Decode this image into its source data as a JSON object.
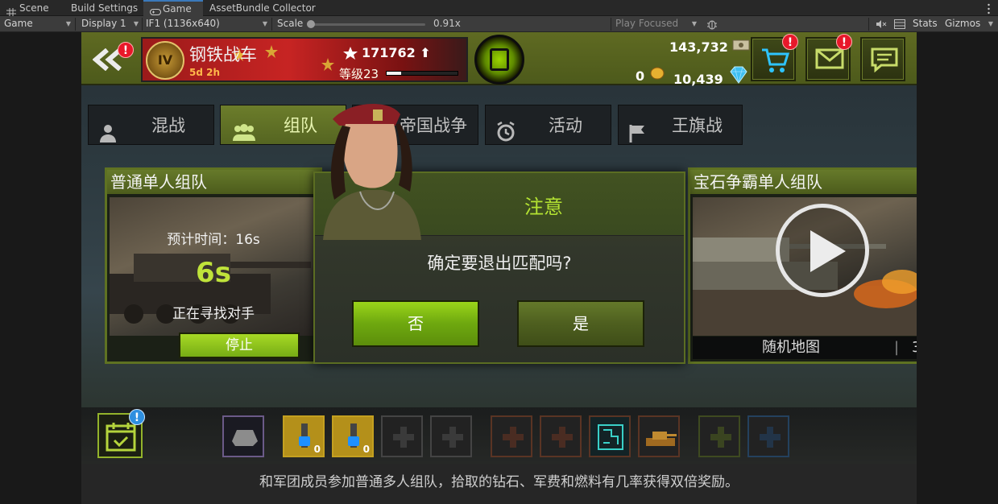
{
  "editor": {
    "tabs": [
      {
        "label": "Scene",
        "icon": "grid-icon"
      },
      {
        "label": "Build Settings"
      },
      {
        "label": "Game",
        "icon": "gamepad-icon",
        "active": true
      },
      {
        "label": "AssetBundle Collector"
      }
    ],
    "toolbar": {
      "view_mode": "Game",
      "display": "Display 1",
      "resolution": "IF1 (1136x640)",
      "scale_label": "Scale",
      "scale_value": "0.91x",
      "play_mode": "Play Focused",
      "stats": "Stats",
      "gizmos": "Gizmos"
    }
  },
  "game": {
    "player": {
      "name": "钢铁战车",
      "rank_numeral": "IV",
      "time_left": "5d 2h",
      "score": "171762",
      "level_label": "等级23",
      "xp_fraction": 0.2
    },
    "resources": {
      "money": "143,732",
      "coins": "0",
      "gems": "10,439"
    },
    "alert_mark": "!",
    "mode_tabs": [
      {
        "label": "混战",
        "icon": "person-icon"
      },
      {
        "label": "组队",
        "icon": "team-icon",
        "active": true
      },
      {
        "label": "帝国战争",
        "icon": "crown-icon"
      },
      {
        "label": "活动",
        "icon": "alarm-clock-icon"
      },
      {
        "label": "王旗战",
        "icon": "flag-icon"
      }
    ],
    "left_card": {
      "title": "普通单人组队",
      "eta_label": "预计时间：16s",
      "countdown": "6s",
      "status": "正在寻找对手",
      "stop_label": "停止"
    },
    "right_card": {
      "title": "宝石争霸单人组队",
      "map_label": "随机地图",
      "map_right": "3"
    },
    "dialog": {
      "title": "注意",
      "message": "确定要退出匹配吗?",
      "no_label": "否",
      "yes_label": "是"
    },
    "slots": {
      "lock_count_1": "0",
      "lock_count_2": "0"
    },
    "notice": "和军团成员参加普通多人组队，拾取的钻石、军费和燃料有几率获得双倍奖励。"
  }
}
